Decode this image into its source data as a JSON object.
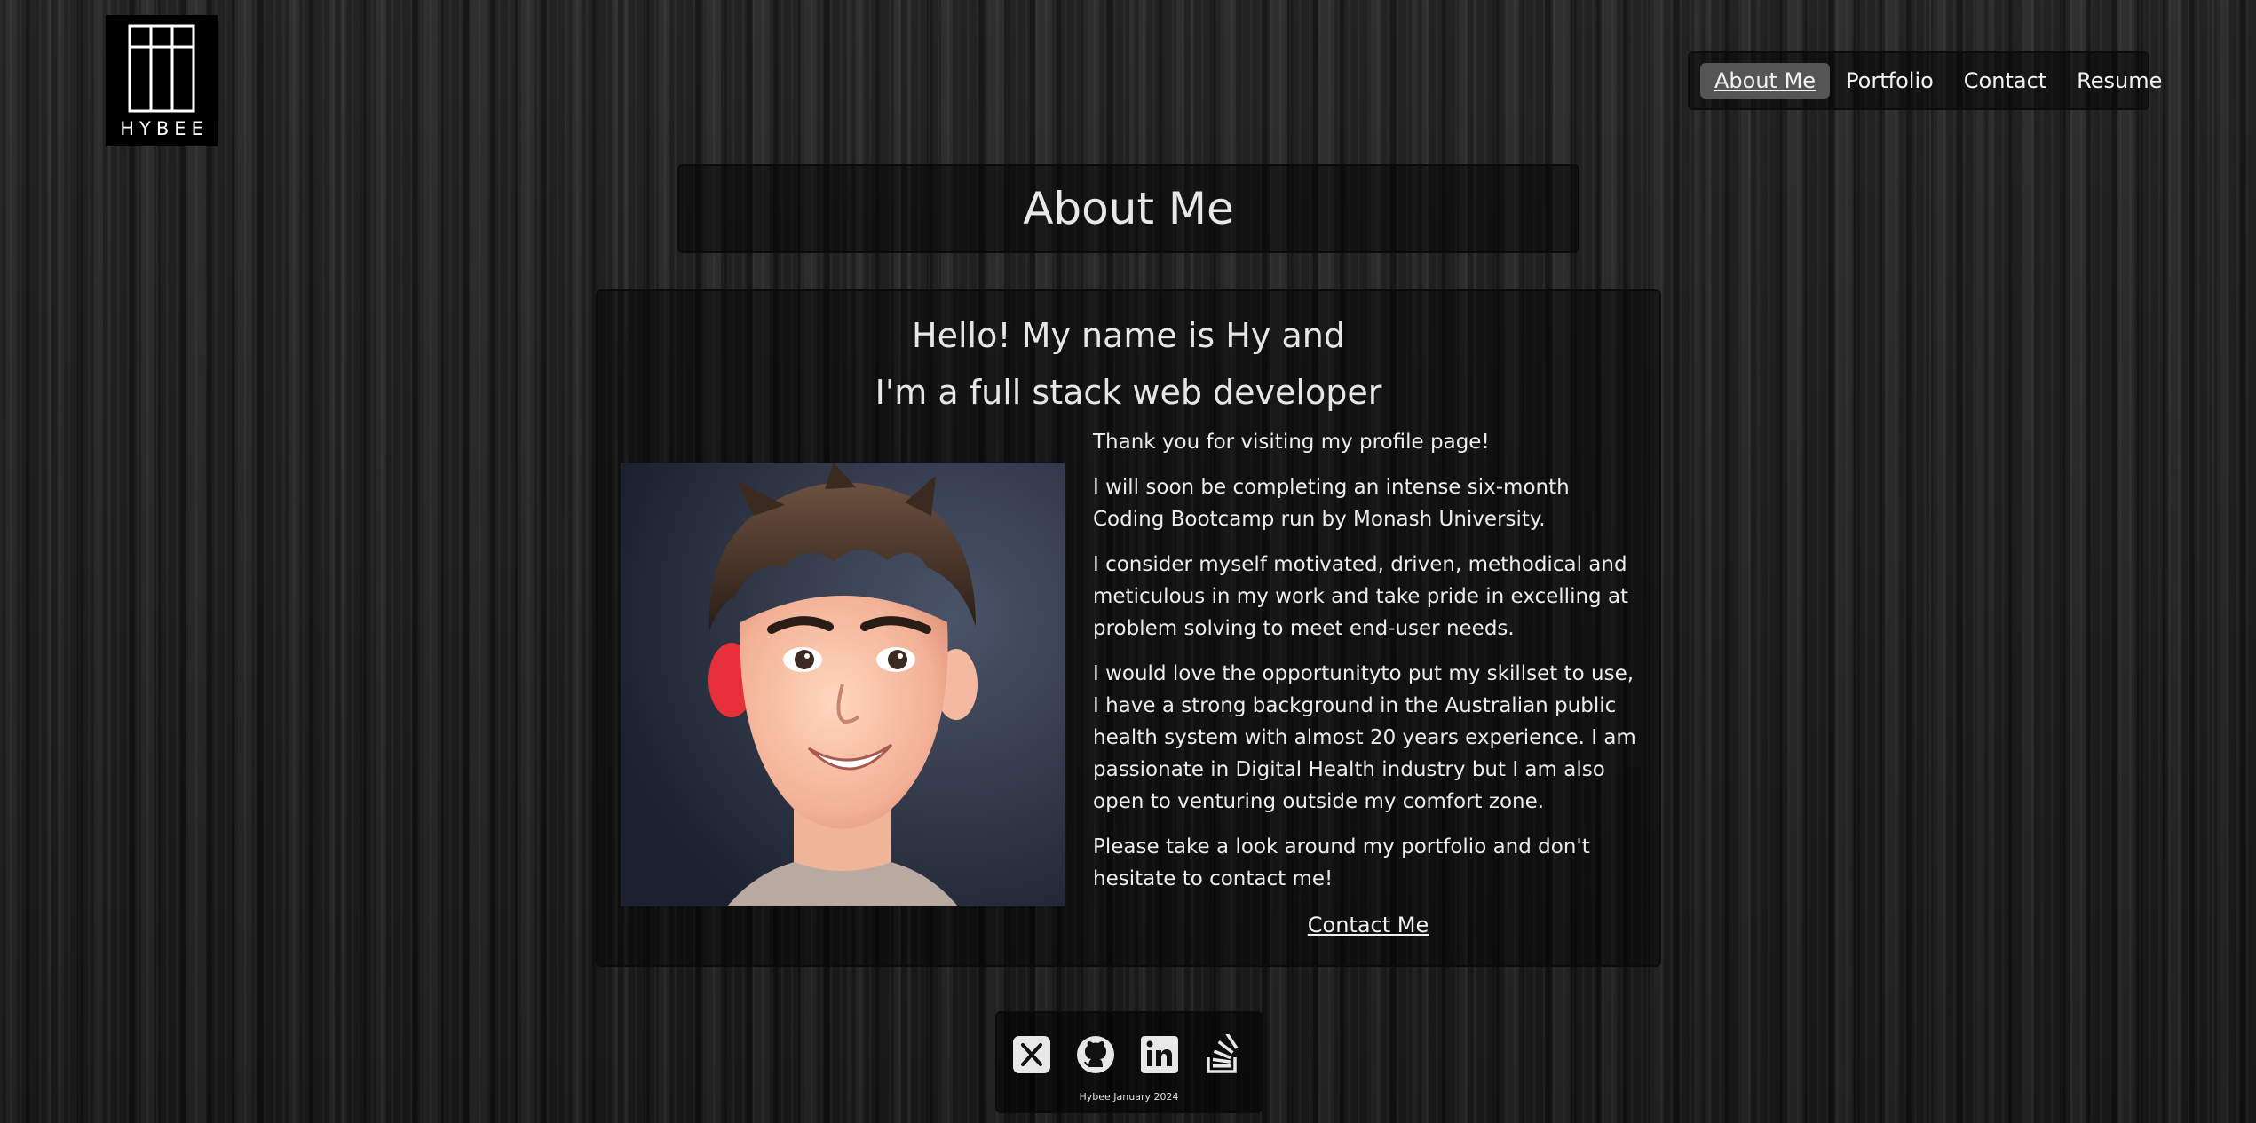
{
  "logo": {
    "text": "HYBEE",
    "icon": "hybee-logo"
  },
  "nav": {
    "items": [
      {
        "label": "About Me",
        "active": true
      },
      {
        "label": "Portfolio",
        "active": false
      },
      {
        "label": "Contact",
        "active": false
      },
      {
        "label": "Resume",
        "active": false
      }
    ]
  },
  "page_title": "About Me",
  "greeting": {
    "line1": "Hello! My name is Hy and",
    "line2": "I'm a full stack web developer"
  },
  "bio": {
    "p1": "Thank you for visiting my profile page!",
    "p2": "I will soon be completing an intense six-month Coding Bootcamp run by Monash University.",
    "p3": "I consider myself motivated, driven, methodical and meticulous in my work and take pride in excelling at problem solving to meet end-user needs.",
    "p4": "I would love the opportunityto put my skillset to use, I have a strong background in the Australian public health system with almost 20 years experience. I am passionate in Digital Health industry but I am also open to venturing outside my comfort zone.",
    "p5": "Please take a look around my portfolio and don't hesitate to contact me!"
  },
  "contact_link": "Contact Me",
  "footer": {
    "text": "Hybee January 2024",
    "socials": [
      "x-icon",
      "github-icon",
      "linkedin-icon",
      "stackoverflow-icon"
    ]
  },
  "colors": {
    "background": "#1b1b1b",
    "panel": "#0b0b0b",
    "active_nav": "#555555",
    "text": "#e6e6e6"
  }
}
